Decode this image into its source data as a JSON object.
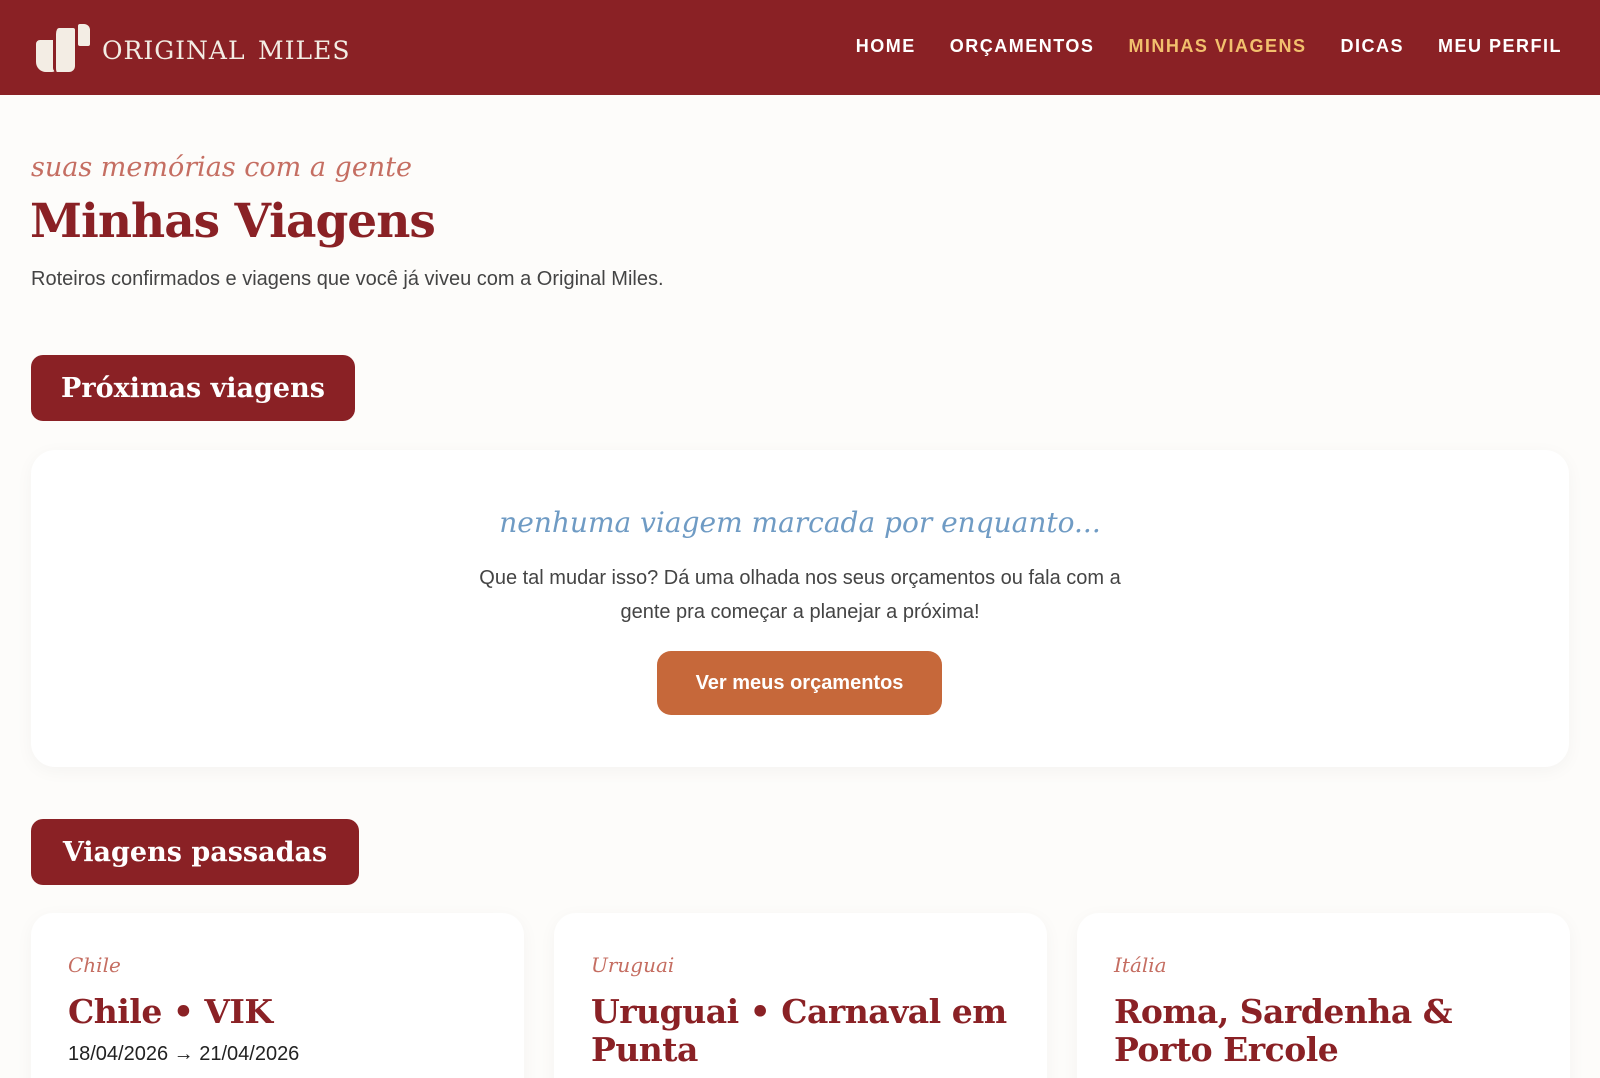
{
  "brand": {
    "name": "original miles"
  },
  "nav": {
    "items": [
      {
        "label": "HOME",
        "active": false
      },
      {
        "label": "ORÇAMENTOS",
        "active": false
      },
      {
        "label": "MINHAS VIAGENS",
        "active": true
      },
      {
        "label": "DICAS",
        "active": false
      },
      {
        "label": "MEU PERFIL",
        "active": false
      }
    ]
  },
  "header": {
    "eyebrow": "suas memórias com a gente",
    "title": "Minhas Viagens",
    "subtitle": "Roteiros confirmados e viagens que você já viveu com a Original Miles."
  },
  "upcoming": {
    "section_label": "Próximas viagens",
    "empty_title": "nenhuma viagem marcada por enquanto...",
    "empty_text": "Que tal mudar isso? Dá uma olhada nos seus orçamentos ou fala com a gente pra começar a planejar a próxima!",
    "cta_label": "Ver meus orçamentos"
  },
  "past": {
    "section_label": "Viagens passadas",
    "trips": [
      {
        "country": "Chile",
        "name": "Chile • VIK",
        "dates": "18/04/2026 → 21/04/2026"
      },
      {
        "country": "Uruguai",
        "name": "Uruguai • Carnaval em Punta",
        "dates": ""
      },
      {
        "country": "Itália",
        "name": "Roma, Sardenha & Porto Ercole",
        "dates": ""
      }
    ]
  },
  "colors": {
    "brand": "#8a2125",
    "nav_active": "#f2c06d",
    "accent": "#c6683a",
    "eyebrow": "#c56e62",
    "empty_title": "#6f9bc4"
  },
  "icons": [
    "logo-mark-icon",
    "arrow-right-icon"
  ]
}
